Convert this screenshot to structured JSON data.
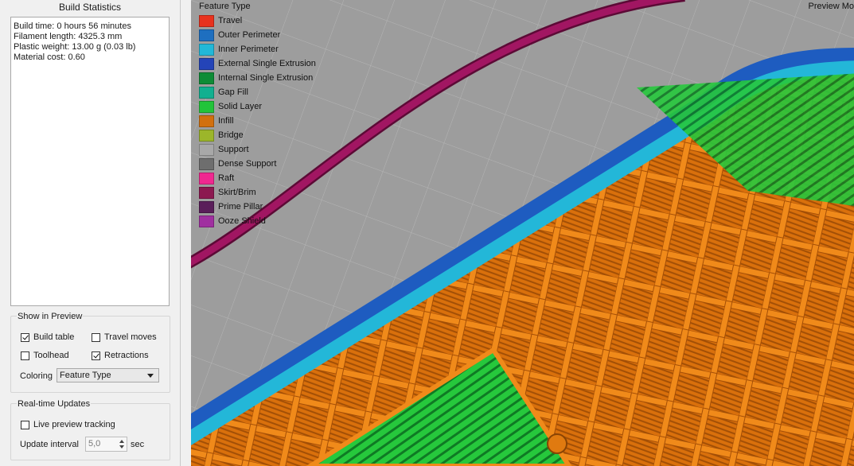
{
  "build_statistics": {
    "title": "Build Statistics",
    "lines": [
      "Build time: 0 hours 56 minutes",
      "Filament length: 4325.3 mm",
      "Plastic weight: 13.00 g (0.03 lb)",
      "Material cost: 0.60"
    ]
  },
  "show_in_preview": {
    "label": "Show in Preview",
    "build_table": {
      "label": "Build table",
      "checked": true
    },
    "travel_moves": {
      "label": "Travel moves",
      "checked": false
    },
    "toolhead": {
      "label": "Toolhead",
      "checked": false
    },
    "retractions": {
      "label": "Retractions",
      "checked": true
    },
    "coloring_label": "Coloring",
    "coloring_value": "Feature Type"
  },
  "realtime_updates": {
    "label": "Real-time Updates",
    "live_preview": {
      "label": "Live preview tracking",
      "checked": false
    },
    "interval_label": "Update interval",
    "interval_value": "5,0",
    "interval_unit": "sec"
  },
  "viewport": {
    "preview_mode_label": "Preview Mo",
    "legend_title": "Feature Type",
    "legend": [
      {
        "label": "Travel",
        "color": "#e8321e"
      },
      {
        "label": "Outer Perimeter",
        "color": "#1e6fc0"
      },
      {
        "label": "Inner Perimeter",
        "color": "#22b8d8"
      },
      {
        "label": "External Single Extrusion",
        "color": "#2444b8"
      },
      {
        "label": "Internal Single Extrusion",
        "color": "#0e8c36"
      },
      {
        "label": "Gap Fill",
        "color": "#12b090"
      },
      {
        "label": "Solid Layer",
        "color": "#22c43a"
      },
      {
        "label": "Infill",
        "color": "#d2700e"
      },
      {
        "label": "Bridge",
        "color": "#9cb62a"
      },
      {
        "label": "Support",
        "color": "#a8a8a8"
      },
      {
        "label": "Dense Support",
        "color": "#6e6e6e"
      },
      {
        "label": "Raft",
        "color": "#f02890"
      },
      {
        "label": "Skirt/Brim",
        "color": "#8c1850"
      },
      {
        "label": "Prime Pillar",
        "color": "#5a1e5a"
      },
      {
        "label": "Ooze Shield",
        "color": "#a030a0"
      }
    ]
  }
}
